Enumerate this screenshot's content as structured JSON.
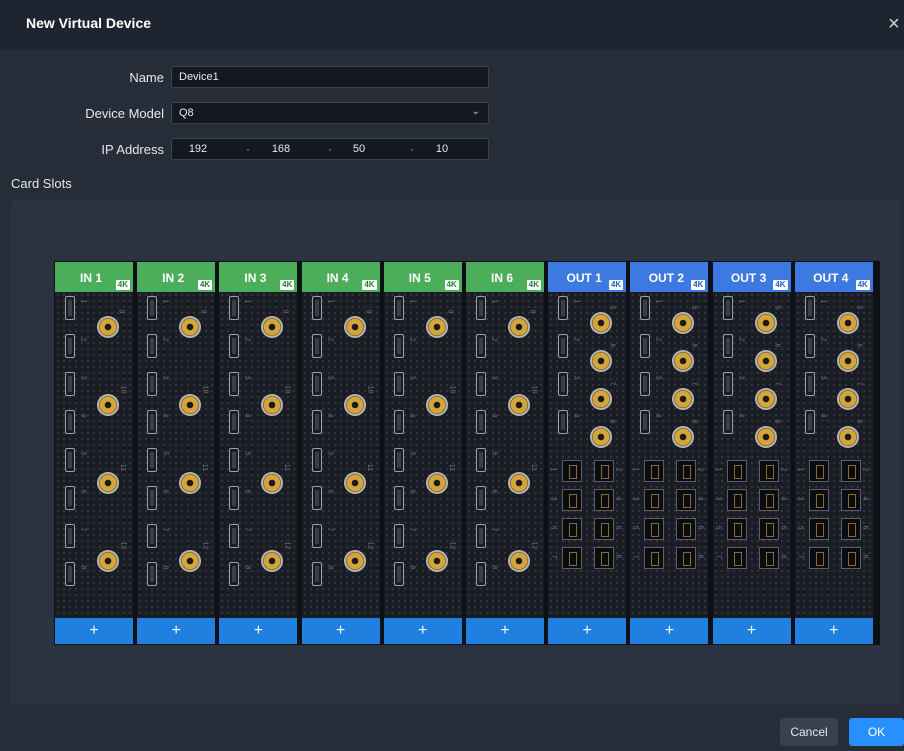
{
  "dialog": {
    "title": "New Virtual Device",
    "close_glyph": "×"
  },
  "form": {
    "name": {
      "label": "Name",
      "value": "Device1"
    },
    "model": {
      "label": "Device Model",
      "value": "Q8",
      "chevron": "⌄"
    },
    "ip": {
      "label": "IP Address",
      "octets": [
        "192",
        "168",
        "50",
        "10"
      ],
      "separator": "·"
    }
  },
  "card_slots": {
    "label": "Card Slots",
    "badge": "4K",
    "add_glyph": "+",
    "cards": [
      {
        "name": "IN 1",
        "kind": "in"
      },
      {
        "name": "IN 2",
        "kind": "in"
      },
      {
        "name": "IN 3",
        "kind": "in"
      },
      {
        "name": "IN 4",
        "kind": "in"
      },
      {
        "name": "IN 5",
        "kind": "in"
      },
      {
        "name": "IN 6",
        "kind": "in"
      },
      {
        "name": "OUT 1",
        "kind": "out"
      },
      {
        "name": "OUT 2",
        "kind": "out"
      },
      {
        "name": "OUT 3",
        "kind": "out"
      },
      {
        "name": "OUT 4",
        "kind": "out"
      }
    ],
    "in_port_labels": {
      "hdmi": [
        "1",
        "2",
        "3",
        "4",
        "5",
        "6",
        "7",
        "8"
      ],
      "bnc": [
        "9",
        "10",
        "11",
        "12"
      ]
    },
    "out_port_labels": {
      "hdmi": [
        "1",
        "2",
        "3",
        "4"
      ],
      "bnc": [
        "5",
        "6",
        "7",
        "8"
      ],
      "rj45": [
        "1",
        "2",
        "3",
        "4",
        "5",
        "6",
        "7",
        "8"
      ]
    }
  },
  "colors": {
    "in_header": "#4cae5a",
    "out_header": "#3c79e0",
    "add_bar": "#2080e0",
    "ok_button": "#2790ff"
  },
  "footer": {
    "cancel_label": "Cancel",
    "ok_label": "OK"
  }
}
